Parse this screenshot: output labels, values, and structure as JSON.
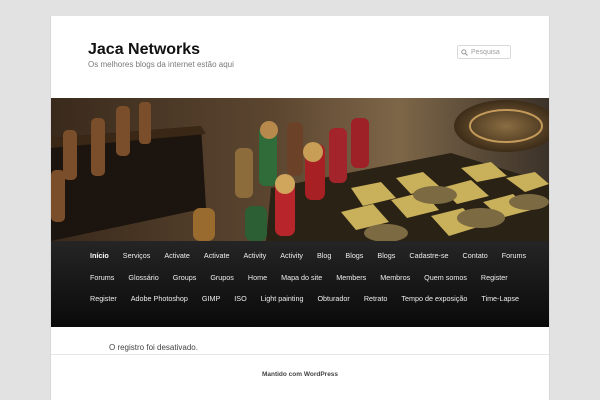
{
  "site": {
    "title": "Jaca Networks",
    "description": "Os melhores blogs da internet estão aqui"
  },
  "search": {
    "placeholder": "Pesquisa",
    "icon": "search-icon"
  },
  "header_image": {
    "description_icon": "chess-board-photo"
  },
  "nav": {
    "items": [
      "Início",
      "Serviços",
      "Activate",
      "Activate",
      "Activity",
      "Activity",
      "Blog",
      "Blogs",
      "Blogs",
      "Cadastre-se",
      "Contato",
      "Forums",
      "Forums",
      "Glossário",
      "Groups",
      "Grupos",
      "Home",
      "Mapa do site",
      "Members",
      "Membros",
      "Quem somos",
      "Register",
      "Register",
      "Adobe Photoshop",
      "GIMP",
      "ISO",
      "Light painting",
      "Obturador",
      "Retrato",
      "Tempo de exposição",
      "Time-Lapse"
    ],
    "current_index": 0
  },
  "content": {
    "message": "O registro foi desativado."
  },
  "footer": {
    "credit": "Mantido com WordPress"
  },
  "colors": {
    "background": "#e2e2e2",
    "nav_bg": "#1a1a1a",
    "nav_text": "#eeeeee"
  }
}
